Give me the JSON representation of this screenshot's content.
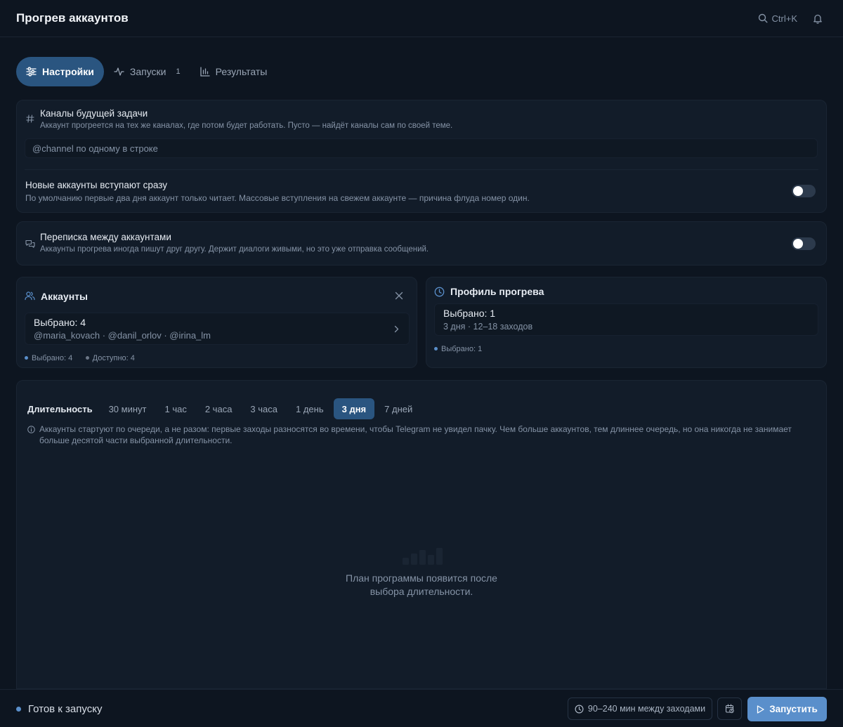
{
  "header": {
    "title": "Прогрев аккаунтов",
    "search_shortcut": "Ctrl+K"
  },
  "tabs": [
    {
      "label": "Настройки",
      "icon": "sliders-icon",
      "active": true
    },
    {
      "label": "Запуски",
      "icon": "activity-icon",
      "badge": "1"
    },
    {
      "label": "Результаты",
      "icon": "bar-chart-icon"
    }
  ],
  "channels": {
    "title": "Каналы будущей задачи",
    "description": "Аккаунт прогреется на тех же каналах, где потом будет работать. Пусто — найдёт каналы сам по своей теме.",
    "placeholder": "@channel по одному в строке",
    "join_title": "Новые аккаунты вступают сразу",
    "join_description": "По умолчанию первые два дня аккаунт только читает. Массовые вступления на свежем аккаунте — причина флуда номер один."
  },
  "chat": {
    "title": "Переписка между аккаунтами",
    "description": "Аккаунты прогрева иногда пишут друг другу. Держит диалоги живыми, но это уже отправка сообщений."
  },
  "accounts": {
    "title": "Аккаунты",
    "selected_label": "Выбрано: 4",
    "usernames": "@maria_kovach · @danil_orlov · @irina_lm",
    "stat_selected": "Выбрано: 4",
    "stat_available": "Доступно: 4"
  },
  "profile": {
    "title": "Профиль прогрева",
    "selected_label": "Выбрано: 1",
    "details": "3 дня · 12–18 заходов",
    "stat_selected": "Выбрано: 1"
  },
  "duration": {
    "label": "Длительность",
    "options": [
      "30 минут",
      "1 час",
      "2 часа",
      "3 часа",
      "1 день",
      "3 дня",
      "7 дней"
    ],
    "selected": "3 дня",
    "note": "Аккаунты стартуют по очереди, а не разом: первые заходы разносятся во времени, чтобы Telegram не увидел пачку. Чем больше аккаунтов, тем длиннее очередь, но она никогда не занимает больше десятой части выбранной длительности.",
    "empty_line1": "План программы появится после",
    "empty_line2": "выбора длительности."
  },
  "footer": {
    "status": "Готов к запуску",
    "interval": "90–240 мин между заходами",
    "run_label": "Запустить"
  },
  "colors": {
    "background": "#0d1520",
    "card": "#121c29",
    "accent": "#2a5580",
    "primary_button": "#5a8fcb",
    "status_dot": "#5a8fcb"
  }
}
